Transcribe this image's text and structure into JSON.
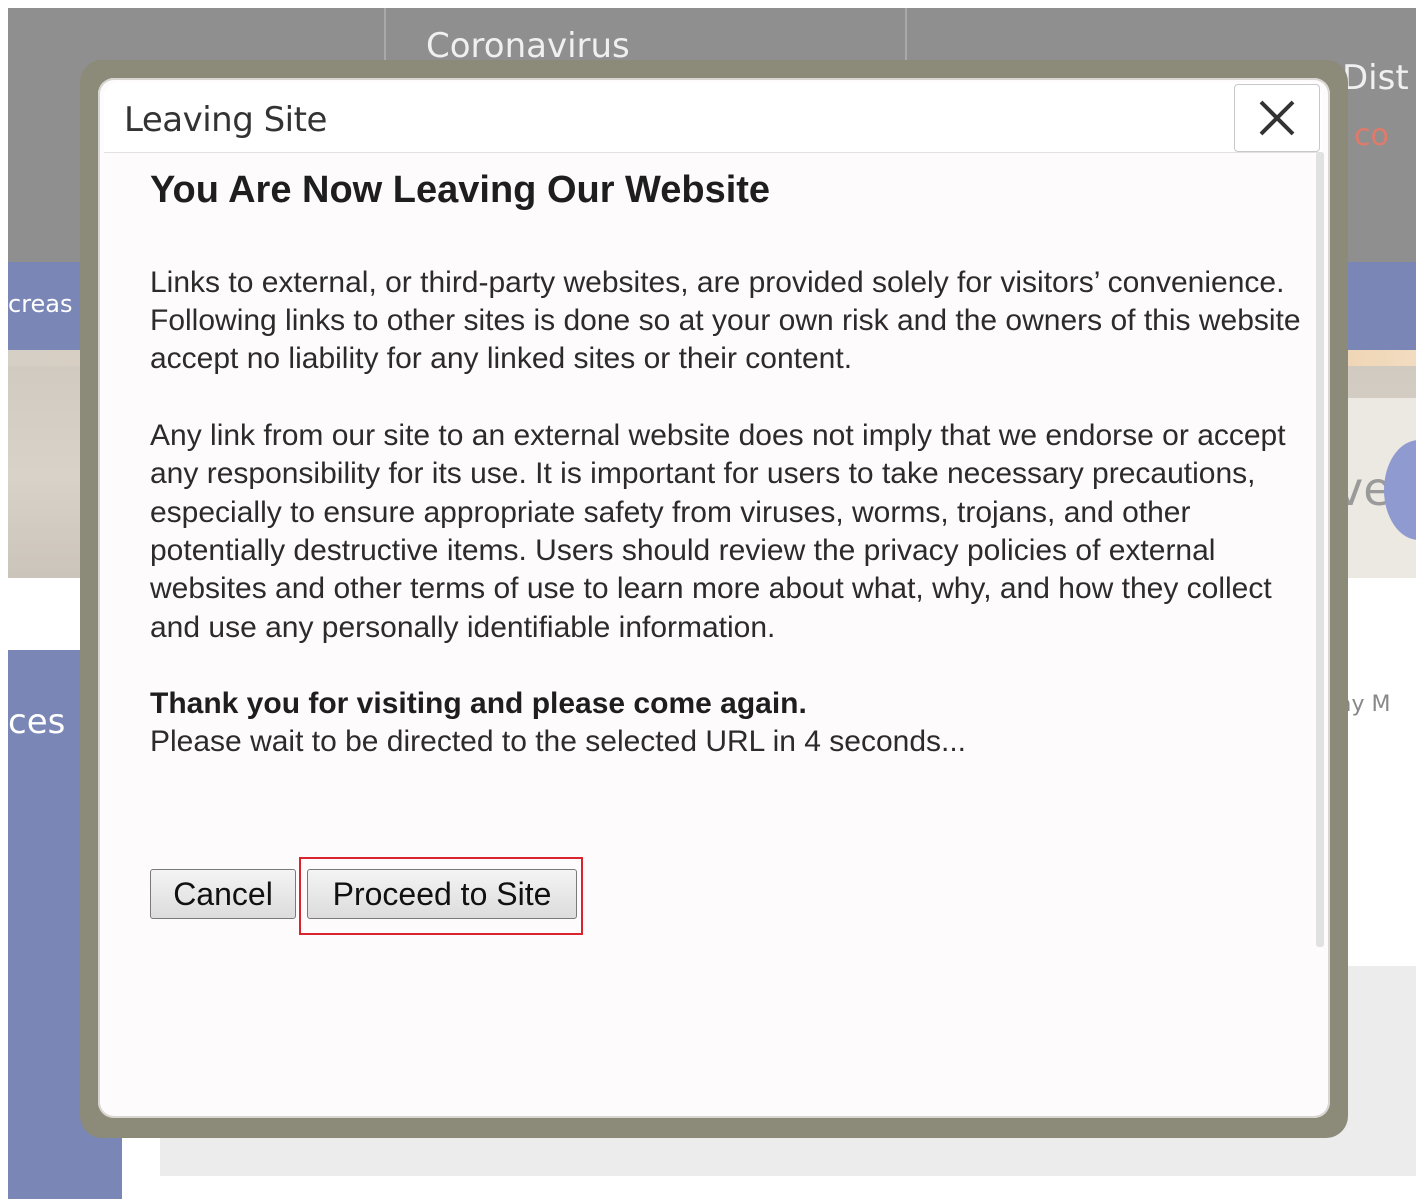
{
  "background": {
    "nav": {
      "item1": "Coronavirus",
      "item2": "Dist",
      "item2_sub": "co"
    },
    "band_text": "creas",
    "side_text": "ces",
    "hero_text": "ve",
    "right_text": "ay M"
  },
  "modal": {
    "title": "Leaving Site",
    "heading": "You Are Now Leaving Our Website",
    "paragraph1": "Links to external, or third-party websites, are provided solely for visitors’ convenience. Following links to other sites is done so at your own risk and the owners of this website accept no liability for any linked sites or their content.",
    "paragraph2": "Any link from our site to an external website does not imply that we endorse or accept any responsibility for its use. It is important for users to take necessary precautions, especially to ensure appropriate safety from viruses, worms, trojans, and other potentially destructive items. Users should review the privacy policies of external websites and other terms of use to learn more about what, why, and how they collect and use any personally identifiable information.",
    "thanks": "Thank you for visiting and please come again.",
    "redirect_notice": "Please wait to be directed to the selected URL in 4 seconds...",
    "cancel_label": "Cancel",
    "proceed_label": "Proceed to Site"
  },
  "colors": {
    "highlight": "#d9232d",
    "frame": "#8c8a78",
    "nav_bg": "#8f8f8f",
    "accent_blue": "#7a86b5"
  },
  "icons": {
    "close": "close-icon"
  }
}
